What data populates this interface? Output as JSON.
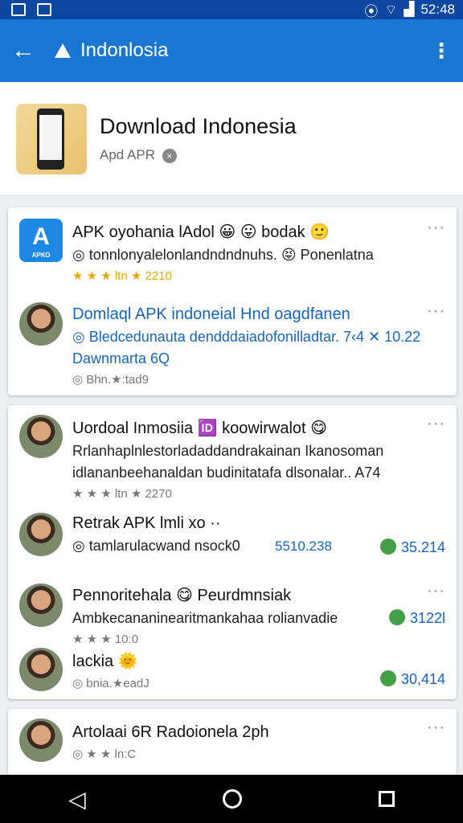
{
  "status": {
    "time": "52:48",
    "left_icons": [
      "image-icon",
      "gallery-icon"
    ],
    "right_icons": [
      "vibrate-icon",
      "wifi-icon",
      "signal-icon",
      "battery-icon"
    ]
  },
  "appbar": {
    "title": "Indonlosia",
    "back_icon": "arrow-left-icon",
    "warn_icon": "warning-icon",
    "more_icon": "more-vert-icon"
  },
  "header": {
    "title": "Download Indonesia",
    "subtitle": "Apd APR"
  },
  "items": [
    {
      "line1": "APK oyohania lAdol 😀 😛 bodak 🙂",
      "line2": "◎ tonnlonyalelonlandndndnuhs. 😝 Ponenlatna",
      "rating": "★ ★ ★ ltn ★ 2210"
    },
    {
      "line1": "Domlaql APK indoneial Hnd oagdfanen",
      "line2": "◎ Bledcedunauta dendddaiadofonilladtar. 7‹4 ✕ 10.228",
      "line3": "Dawnmarta 6Q",
      "rating": "◎ Bhn.★:tad9"
    },
    {
      "line1": "Uordoal Inmosiia 🆔 koowirwalot 😋",
      "line2": "Rrlanhaplnlestorladaddandrakainan Ikanosoman",
      "line2b": "idlananbeehanaldan budinitatafa dlsonalar.. A74",
      "rating": "★ ★ ★ ltn ★ 2270"
    },
    {
      "line1": "Retrak APK lmli xo ··",
      "line2": "◎ tamlarulacwand nsock0",
      "badge": "5510.238",
      "count": "35.214"
    },
    {
      "line1": "Pennoritehala 😋 Peurdmnsiak",
      "line2": "Ambkecananinearitmankahaa rolianvadies..",
      "count": "3122l",
      "rating": "★ ★ ★ 10:0"
    },
    {
      "line1": "lackia 🌞",
      "line2": "◎ bnia.★eadJ",
      "count": "30,414"
    },
    {
      "line1": "Artolaai 6R Radoionela 2ph",
      "rating": "◎ ★ ★ ln:C"
    }
  ],
  "nav": {
    "back": "◁",
    "home": "home",
    "recent": "recent"
  }
}
